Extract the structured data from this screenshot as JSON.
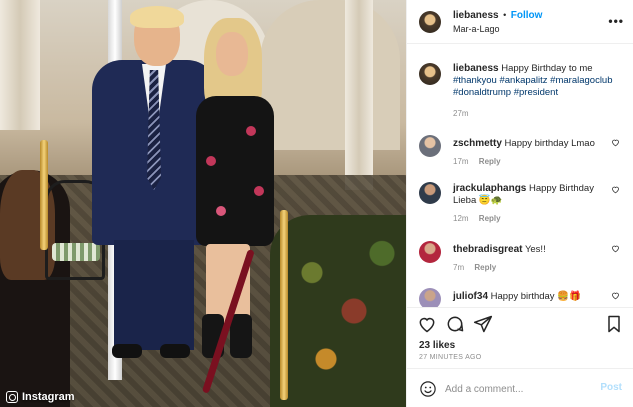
{
  "photo": {
    "watermark": "Instagram"
  },
  "header": {
    "username": "liebaness",
    "follow_label": "Follow",
    "separator": "•",
    "location": "Mar-a-Lago",
    "more_icon": "more-horizontal-icon"
  },
  "caption": {
    "username": "liebaness",
    "text": "Happy Birthday to me",
    "hashtags": "#thankyou #ankapalitz #maralagoclub #donaldtrump #president",
    "time": "27m"
  },
  "comments": [
    {
      "username": "zschmetty",
      "text": "Happy birthday Lmao",
      "time": "17m",
      "reply": "Reply"
    },
    {
      "username": "jrackulaphangs",
      "text": "Happy Birthday Lieba 😇🐢",
      "time": "12m",
      "reply": "Reply"
    },
    {
      "username": "thebradisgreat",
      "text": "Yes!!",
      "time": "7m",
      "reply": "Reply"
    },
    {
      "username": "juliof34",
      "text": "Happy birthday 🍔🎁",
      "time": "",
      "reply": ""
    }
  ],
  "actions": {
    "likes": "23 likes",
    "time_ago": "27 MINUTES AGO"
  },
  "add_comment": {
    "placeholder": "Add a comment...",
    "post_label": "Post"
  },
  "colors": {
    "link_blue": "#0095f6",
    "hashtag_blue": "#00376b",
    "muted": "#8e8e8e",
    "post_disabled": "#b2dffc"
  }
}
